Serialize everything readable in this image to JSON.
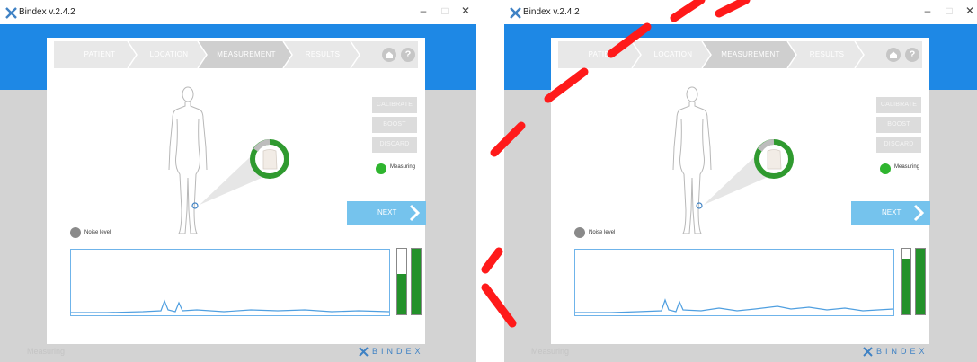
{
  "windows": [
    {
      "title": "Bindex v.2.4.2",
      "steps": [
        "PATIENT",
        "LOCATION",
        "MEASUREMENT",
        "RESULTS"
      ],
      "active_step": 2,
      "home_icon": "home-icon",
      "help_label": "?",
      "buttons": {
        "calibrate": "CALIBRATE",
        "boost": "BOOST",
        "discard": "DISCARD"
      },
      "measuring_label": "Measuring",
      "next_label": "NEXT",
      "noise_label": "Noise level",
      "status_text": "Measuring",
      "brand": "BINDEX",
      "level_bar_1": 0.62,
      "level_bar_2": 1.0,
      "progress_ring": 0.75
    },
    {
      "title": "Bindex v.2.4.2",
      "steps": [
        "PATIENT",
        "LOCATION",
        "MEASUREMENT",
        "RESULTS"
      ],
      "active_step": 2,
      "home_icon": "home-icon",
      "help_label": "?",
      "buttons": {
        "calibrate": "CALIBRATE",
        "boost": "BOOST",
        "discard": "DISCARD"
      },
      "measuring_label": "Measuring",
      "next_label": "NEXT",
      "noise_label": "Noise level",
      "status_text": "Measuring",
      "brand": "BINDEX",
      "level_bar_1": 0.85,
      "level_bar_2": 1.0,
      "progress_ring": 0.75
    }
  ],
  "colors": {
    "accent_blue": "#1e88e5",
    "next_button": "#75c3ed",
    "measuring_green": "#2fb52f",
    "level_green": "#23912a",
    "noise_gray": "#8a8a8a",
    "signal_blue": "#4f9fe0"
  }
}
